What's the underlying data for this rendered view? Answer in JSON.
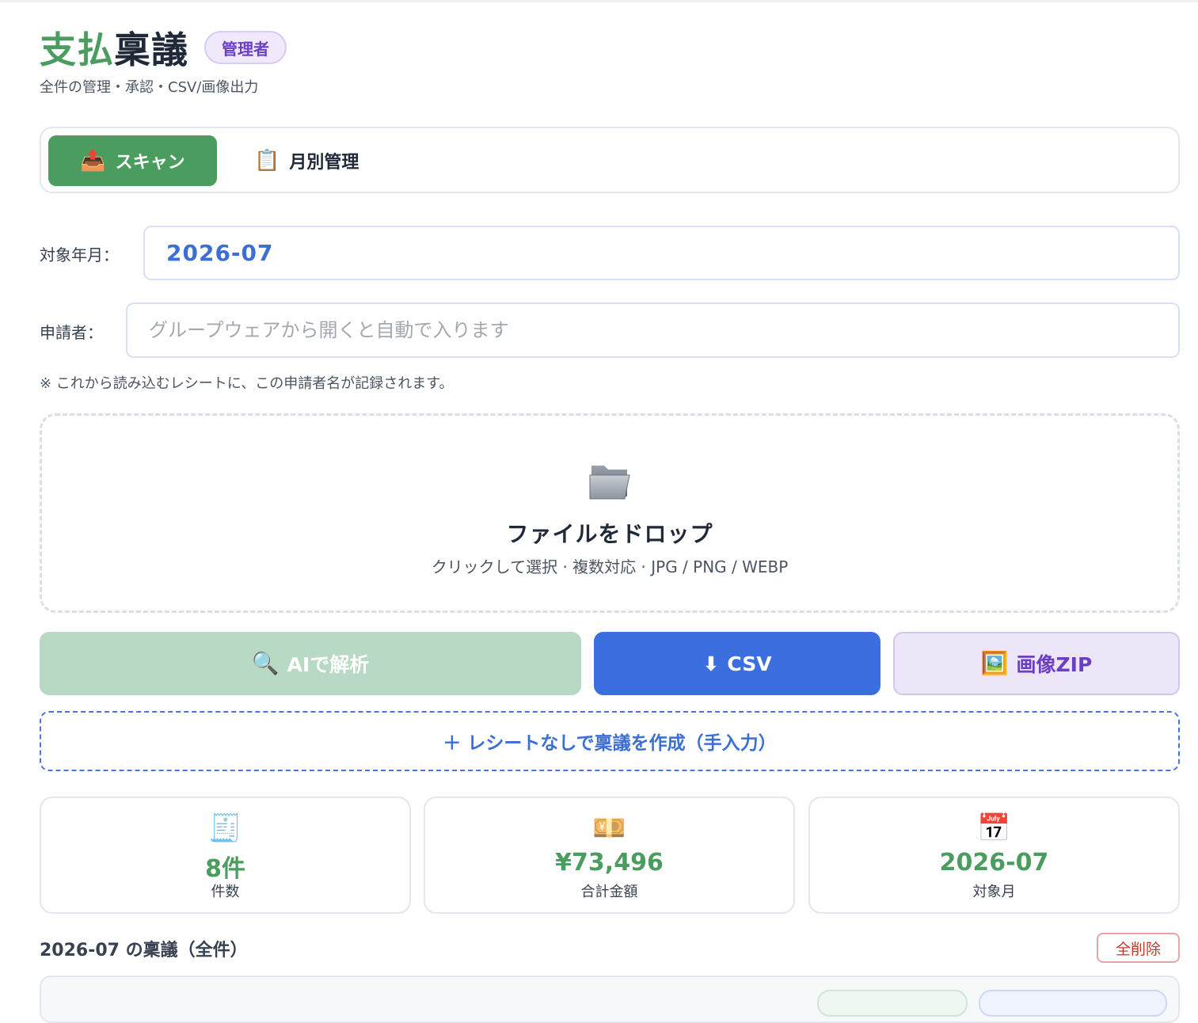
{
  "header": {
    "title_part1": "支払",
    "title_part2": "稟議",
    "role_badge": "管理者",
    "subtitle": "全件の管理・承認・CSV/画像出力"
  },
  "tabs": [
    {
      "icon": "📤",
      "icon_name": "inbox-tray-icon",
      "label": "スキャン",
      "active": true
    },
    {
      "icon": "📋",
      "icon_name": "clipboard-icon",
      "label": "月別管理",
      "active": false
    }
  ],
  "form": {
    "month_label": "対象年月：",
    "month_value": "2026-07",
    "applicant_label": "申請者：",
    "applicant_value": "",
    "applicant_placeholder": "グループウェアから開くと自動で入ります",
    "note": "※ これから読み込むレシートに、この申請者名が記録されます。"
  },
  "dropzone": {
    "icon_name": "folder-icon",
    "title": "ファイルをドロップ",
    "subtitle": "クリックして選択 · 複数対応 · JPG / PNG / WEBP"
  },
  "actions": {
    "ai_icon": "🔍",
    "ai_label": "AIで解析",
    "csv_icon": "⬇",
    "csv_label": "CSV",
    "zip_icon": "🖼️",
    "zip_label": "画像ZIP",
    "manual_label": "＋ レシートなしで稟議を作成（手入力）"
  },
  "stats": [
    {
      "icon": "🧾",
      "icon_name": "receipt-icon",
      "value": "8件",
      "label": "件数"
    },
    {
      "icon": "💴",
      "icon_name": "yen-banknote-icon",
      "value": "¥73,496",
      "label": "合計金額"
    },
    {
      "icon": "📅",
      "icon_name": "calendar-icon",
      "value": "2026-07",
      "label": "対象月"
    }
  ],
  "list": {
    "title": "2026-07 の稟議（全件）",
    "delete_all_label": "全削除"
  },
  "colors": {
    "brand_green": "#4a9d5f",
    "primary_blue": "#3b6fe0",
    "purple": "#6a3fc4",
    "danger": "#c0392b"
  }
}
